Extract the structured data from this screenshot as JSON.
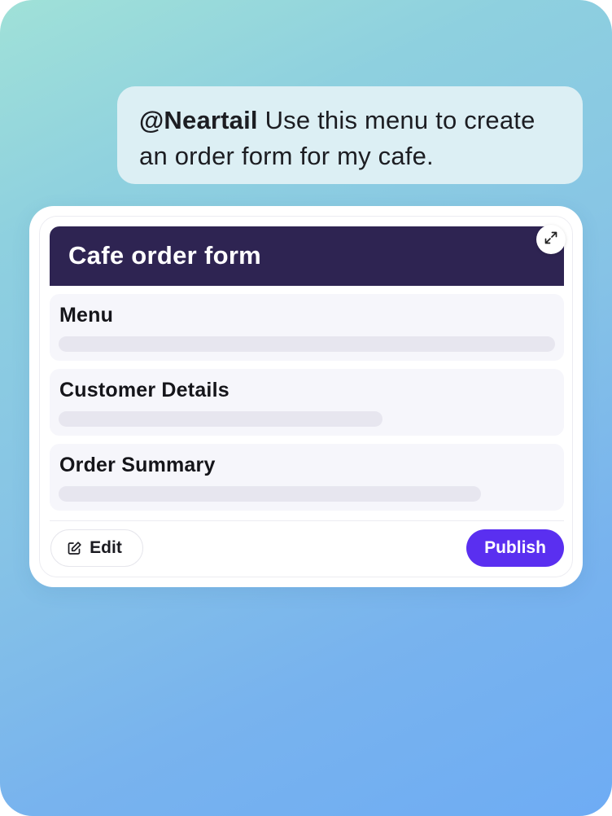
{
  "chat": {
    "mention": "@Neartail",
    "message_line1": " Use this menu to create",
    "message_line2": "an order form for my cafe."
  },
  "form": {
    "title": "Cafe order form",
    "sections": [
      {
        "title": "Menu"
      },
      {
        "title": "Customer Details"
      },
      {
        "title": "Order Summary"
      }
    ]
  },
  "footer": {
    "edit_label": "Edit",
    "publish_label": "Publish"
  },
  "icons": {
    "expand": "expand-icon",
    "edit": "edit-icon"
  },
  "colors": {
    "header_bg": "#2e2452",
    "publish_bg": "#5a2ff0",
    "bubble_bg": "#dceff4"
  }
}
